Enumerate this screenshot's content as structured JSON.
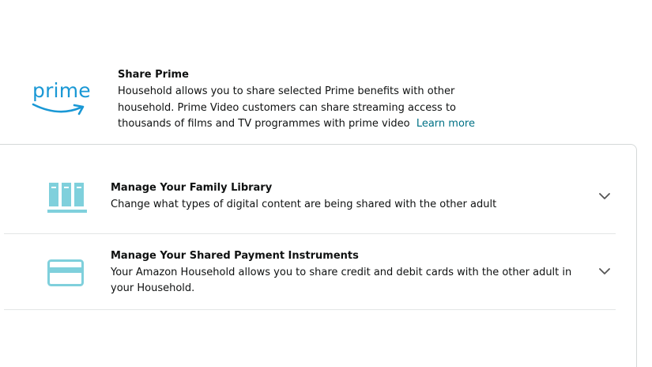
{
  "prime": {
    "logo_word": "prime",
    "title": "Share Prime",
    "description": "Household allows you to share selected Prime benefits with other household. Prime Video customers can share streaming access to thousands of films and TV programmes with prime video",
    "link": "Learn more",
    "brand_color": "#1a98d5"
  },
  "sections": [
    {
      "title": "Manage Your Family Library",
      "description": "Change what types of digital content are being shared with the other adult",
      "icon": "library-icon",
      "toggle_icon": "chevron-down-icon"
    },
    {
      "title": "Manage Your Shared Payment Instruments",
      "description": "Your Amazon Household allows you to share credit and debit cards with the other adult in your Household.",
      "icon": "credit-card-icon",
      "toggle_icon": "chevron-down-icon"
    }
  ],
  "colors": {
    "icon_accent": "#7fd0dc",
    "link": "#007185",
    "divider": "#e3e6e6"
  }
}
